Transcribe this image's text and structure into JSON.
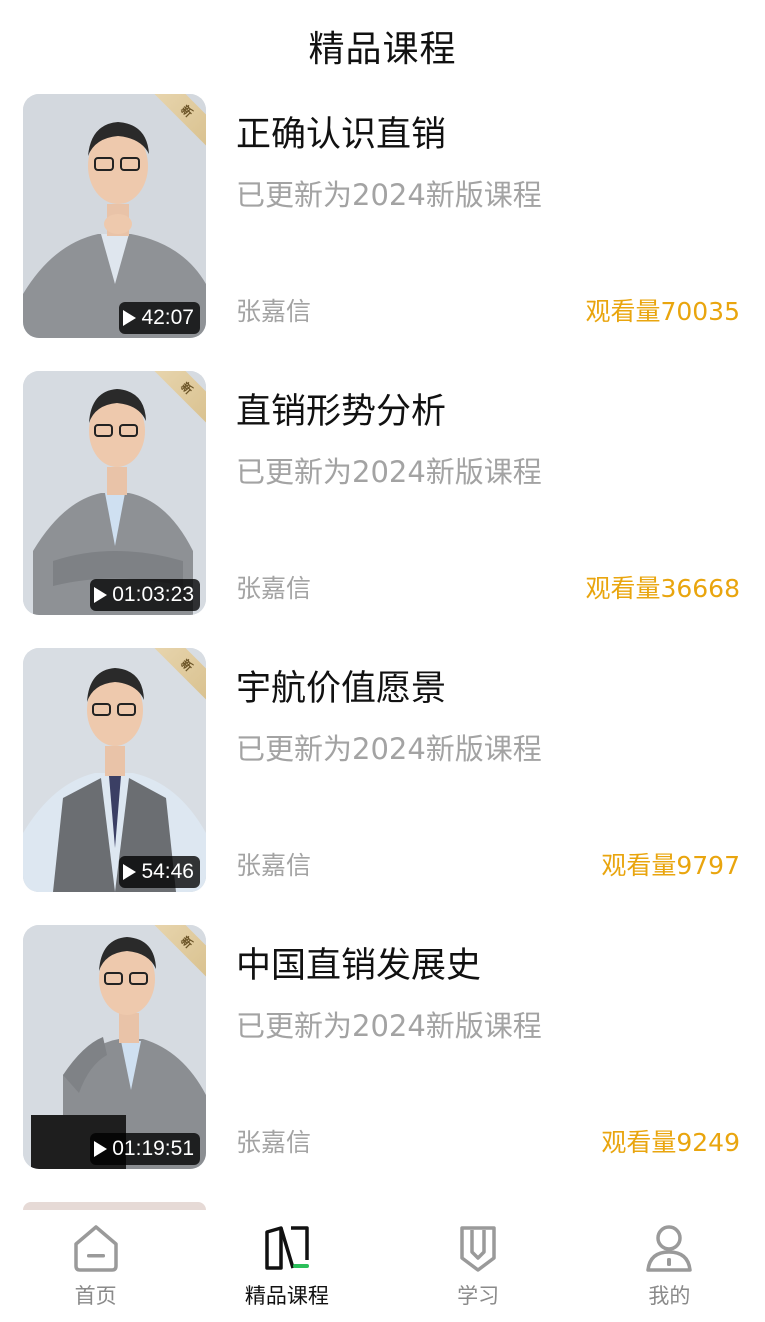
{
  "header": {
    "title": "精品课程"
  },
  "ribbon_label": "新",
  "courses": [
    {
      "title": "正确认识直销",
      "subtitle": "已更新为2024新版课程",
      "author": "张嘉信",
      "views": "观看量70035",
      "duration": "42:07"
    },
    {
      "title": "直销形势分析",
      "subtitle": "已更新为2024新版课程",
      "author": "张嘉信",
      "views": "观看量36668",
      "duration": "01:03:23"
    },
    {
      "title": "宇航价值愿景",
      "subtitle": "已更新为2024新版课程",
      "author": "张嘉信",
      "views": "观看量9797",
      "duration": "54:46"
    },
    {
      "title": "中国直销发展史",
      "subtitle": "已更新为2024新版课程",
      "author": "张嘉信",
      "views": "观看量9249",
      "duration": "01:19:51"
    }
  ],
  "tabbar": {
    "items": [
      {
        "label": "首页",
        "icon": "home-icon",
        "active": false
      },
      {
        "label": "精品课程",
        "icon": "book-icon",
        "active": true
      },
      {
        "label": "学习",
        "icon": "pencil-icon",
        "active": false
      },
      {
        "label": "我的",
        "icon": "user-icon",
        "active": false
      }
    ]
  },
  "colors": {
    "views": "#e9a50e",
    "muted": "#a3a3a3",
    "accent_green": "#2bbf5a"
  }
}
